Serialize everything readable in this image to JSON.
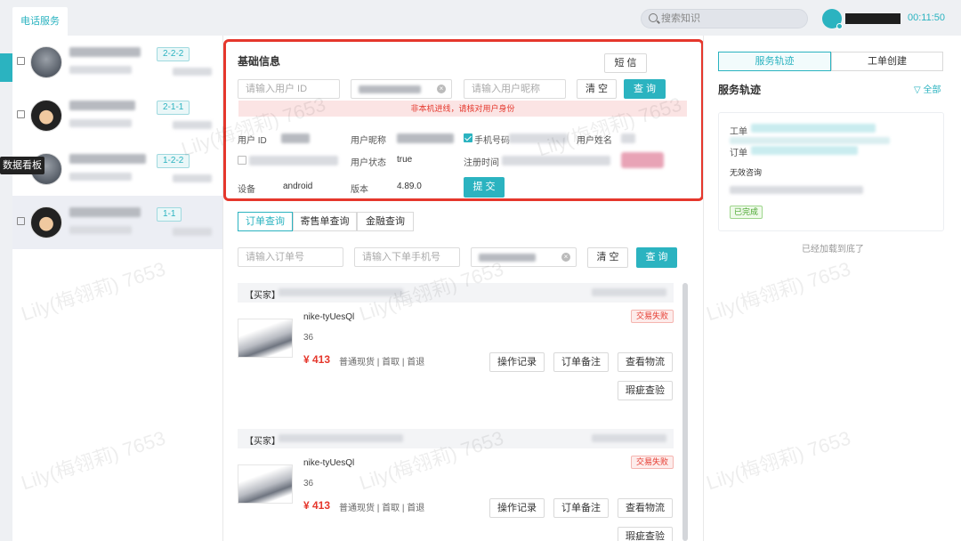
{
  "topbar": {
    "phone_tab": "电话服务",
    "search_placeholder": "搜索知识",
    "timer": "00:11:50"
  },
  "sessions": [
    {
      "badge": "2-2-2"
    },
    {
      "badge": "2-1-1"
    },
    {
      "badge": "1-2-2"
    },
    {
      "badge": "1-1"
    }
  ],
  "tooltip": "数据看板",
  "basic": {
    "title": "基础信息",
    "sms_button": "短 信",
    "user_id_placeholder": "请输入用户 ID",
    "nickname_placeholder": "请输入用户昵称",
    "clear_button": "清 空",
    "query_button": "查 询",
    "warning": "非本机进线，请核对用户身份",
    "labels": {
      "user_id": "用户 ID",
      "nickname": "用户昵称",
      "phone": "手机号码",
      "real_name": "用户姓名",
      "status": "用户状态",
      "register": "注册时间",
      "device": "设备",
      "version": "版本"
    },
    "values": {
      "status": "true",
      "device": "android",
      "version": "4.89.0"
    },
    "submit_button": "提 交"
  },
  "order_tabs": [
    "订单查询",
    "寄售单查询",
    "金融查询"
  ],
  "order_search": {
    "order_placeholder": "请输入订单号",
    "phone_placeholder": "请输入下单手机号",
    "clear_button": "清 空",
    "query_button": "查 询"
  },
  "orders": [
    {
      "buyer_label": "【买家】",
      "product": "nike-tyUesQl",
      "size": "36",
      "price": "¥ 413",
      "meta": "普通现货 | 首取 | 首退",
      "status": "交易失败",
      "actions": [
        "操作记录",
        "订单备注",
        "查看物流",
        "瑕疵查验"
      ]
    },
    {
      "buyer_label": "【买家】",
      "product": "nike-tyUesQl",
      "size": "36",
      "price": "¥ 413",
      "meta": "普通现货 | 首取 | 首退",
      "status": "交易失败",
      "actions": [
        "操作记录",
        "订单备注",
        "查看物流",
        "瑕疵查验"
      ]
    }
  ],
  "right": {
    "tabs": [
      "服务轨迹",
      "工单创建"
    ],
    "title": "服务轨迹",
    "filter": "全部",
    "card": {
      "ticket_label": "工单",
      "order_label": "订单",
      "type": "无效咨询",
      "status": "已完成"
    },
    "end_text": "已经加载到底了"
  },
  "watermark": "Lily(梅翎莉) 7653",
  "colors": {
    "accent": "#2bb3c0",
    "danger": "#e5372c",
    "success": "#49a52f"
  }
}
